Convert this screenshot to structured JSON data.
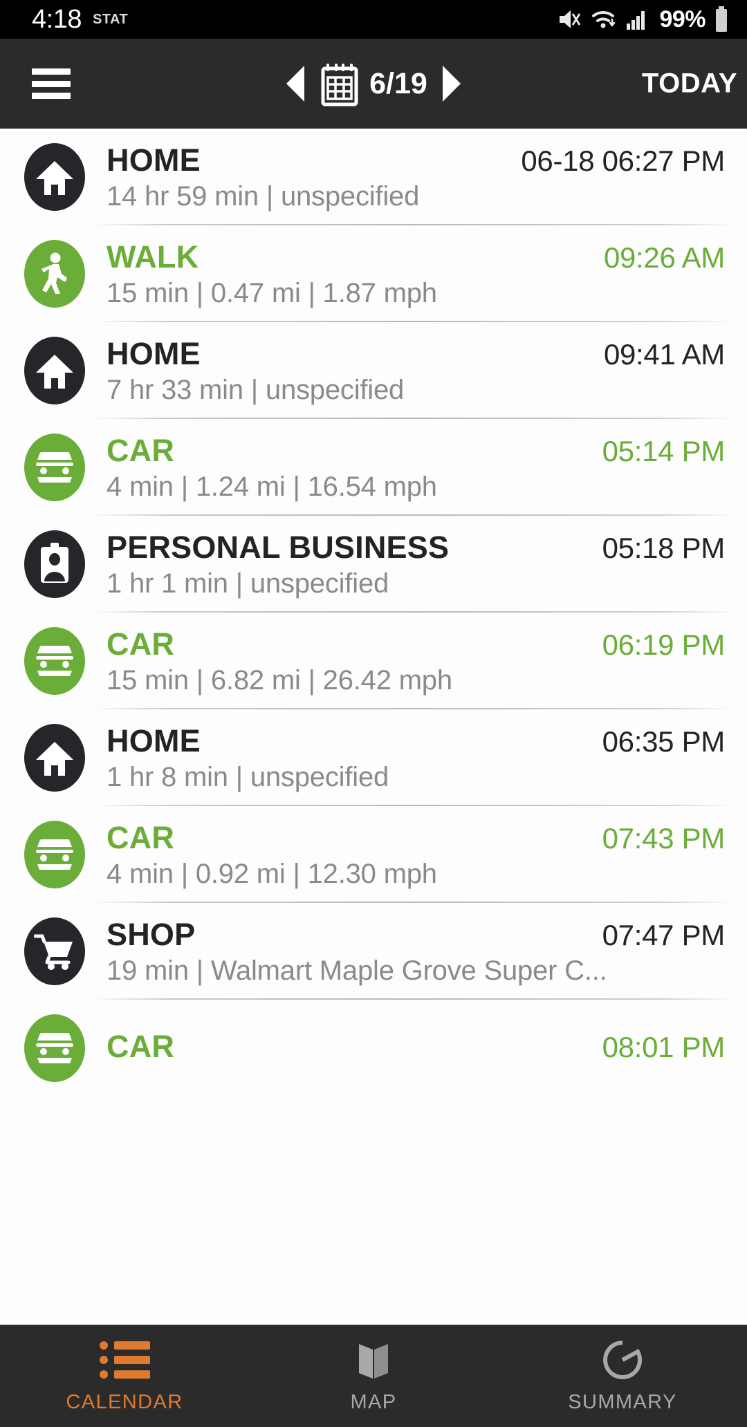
{
  "status_bar": {
    "time": "4:18",
    "stat_label": "STAT",
    "battery_percent": "99%",
    "icons": [
      "mute-vibrate-icon",
      "wifi-icon",
      "cellular-signal-icon",
      "battery-icon"
    ]
  },
  "app_bar": {
    "menu_icon": "hamburger-menu-icon",
    "prev_icon": "previous-day-arrow-icon",
    "next_icon": "next-day-arrow-icon",
    "calendar_icon": "calendar-icon",
    "date": "6/19",
    "today_label": "TODAY"
  },
  "colors": {
    "accent_green": "#6aad38",
    "accent_orange": "#e07a2e",
    "dark_badge": "#26262a",
    "appbar_bg": "#2b2b2b",
    "primary_text": "#232323",
    "secondary_text": "#8a8a8a"
  },
  "entries": [
    {
      "title": "HOME",
      "time": "06-18 06:27 PM",
      "subtitle": "14 hr 59 min | unspecified",
      "icon": "home-icon",
      "style": "dark"
    },
    {
      "title": "WALK",
      "time": "09:26 AM",
      "subtitle": "15 min | 0.47 mi | 1.87 mph",
      "icon": "walking-person-icon",
      "style": "green"
    },
    {
      "title": "HOME",
      "time": "09:41 AM",
      "subtitle": "7 hr 33 min | unspecified",
      "icon": "home-icon",
      "style": "dark"
    },
    {
      "title": "CAR",
      "time": "05:14 PM",
      "subtitle": "4 min | 1.24 mi | 16.54 mph",
      "icon": "car-icon",
      "style": "green"
    },
    {
      "title": "PERSONAL BUSINESS",
      "time": "05:18 PM",
      "subtitle": "1 hr 1 min | unspecified",
      "icon": "id-badge-person-icon",
      "style": "dark"
    },
    {
      "title": "CAR",
      "time": "06:19 PM",
      "subtitle": "15 min | 6.82 mi | 26.42 mph",
      "icon": "car-icon",
      "style": "green"
    },
    {
      "title": "HOME",
      "time": "06:35 PM",
      "subtitle": "1 hr 8 min | unspecified",
      "icon": "home-icon",
      "style": "dark"
    },
    {
      "title": "CAR",
      "time": "07:43 PM",
      "subtitle": "4 min | 0.92 mi | 12.30 mph",
      "icon": "car-icon",
      "style": "green"
    },
    {
      "title": "SHOP",
      "time": "07:47 PM",
      "subtitle": "19 min | Walmart Maple Grove Super C...",
      "icon": "shopping-cart-icon",
      "style": "dark"
    },
    {
      "title": "CAR",
      "time": "08:01 PM",
      "subtitle": "",
      "icon": "car-icon",
      "style": "green"
    }
  ],
  "bottom_nav": [
    {
      "label": "CALENDAR",
      "icon": "calendar-list-icon",
      "active": true
    },
    {
      "label": "MAP",
      "icon": "map-icon",
      "active": false
    },
    {
      "label": "SUMMARY",
      "icon": "summary-ring-icon",
      "active": false
    }
  ]
}
